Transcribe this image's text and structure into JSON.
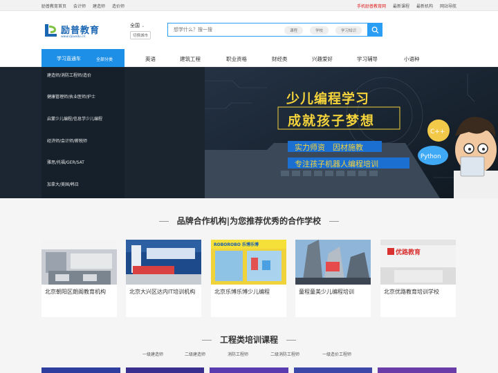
{
  "topbar": {
    "left_links": [
      "励普教育首页",
      "会计师",
      "建造师",
      "造价师"
    ],
    "right_links": [
      "手机励普教育网",
      "最新课程",
      "最新机构",
      "网站导航"
    ]
  },
  "header": {
    "logo_name": "励普教育",
    "logo_url": "www.lipuedu.cn",
    "city": "全国",
    "city_switch": "切换城市",
    "search_placeholder": "想学什么？搜一搜",
    "search_tags": [
      "课程",
      "学校",
      "学习知识"
    ]
  },
  "nav": {
    "category_label": "学习直通车",
    "all_label": "全部分类",
    "items": [
      "英语",
      "建筑工程",
      "职业资格",
      "财经类",
      "兴趣爱好",
      "学习辅导",
      "小语种"
    ]
  },
  "side_menu": [
    "建造师/消防工程师/造价",
    "健康管理师/执业医师/护士",
    "启蒙少儿编程/信息学少儿编程",
    "经济师/会计师/薪税师",
    "雅思/托福/GER/SAT",
    "加拿大/美国/韩日"
  ],
  "banner": {
    "headline1": "少儿编程学习",
    "headline2": "成就孩子梦想",
    "slogan1": "实力师资　因材施教",
    "slogan2": "专注孩子机器人编程培训",
    "bubble1": "C++",
    "bubble2": "Python"
  },
  "brand_section": {
    "title": "品牌合作机构|为您推荐优秀的合作学校",
    "cards": [
      {
        "title": "北京朝阳区朗阁教育机构",
        "sign": ""
      },
      {
        "title": "北京大兴区达内IT培训机构",
        "sign": ""
      },
      {
        "title": "北京乐博乐博少儿编程",
        "sign": "ROBOROBO 乐博乐博"
      },
      {
        "title": "童程童美少儿编程培训",
        "sign": ""
      },
      {
        "title": "北京优路教育培训学校",
        "sign": "优路教育"
      }
    ]
  },
  "course_section": {
    "title": "工程类培训课程",
    "tabs": [
      "一级建造师",
      "二级建造师",
      "消防工程师",
      "二级消防工程师",
      "一级造价工程师"
    ]
  },
  "colors": {
    "accent": "#1e8fe6",
    "hot": "#e02020",
    "banner_yellow": "#f5d33b",
    "banner_blue": "#1b6fd1"
  }
}
